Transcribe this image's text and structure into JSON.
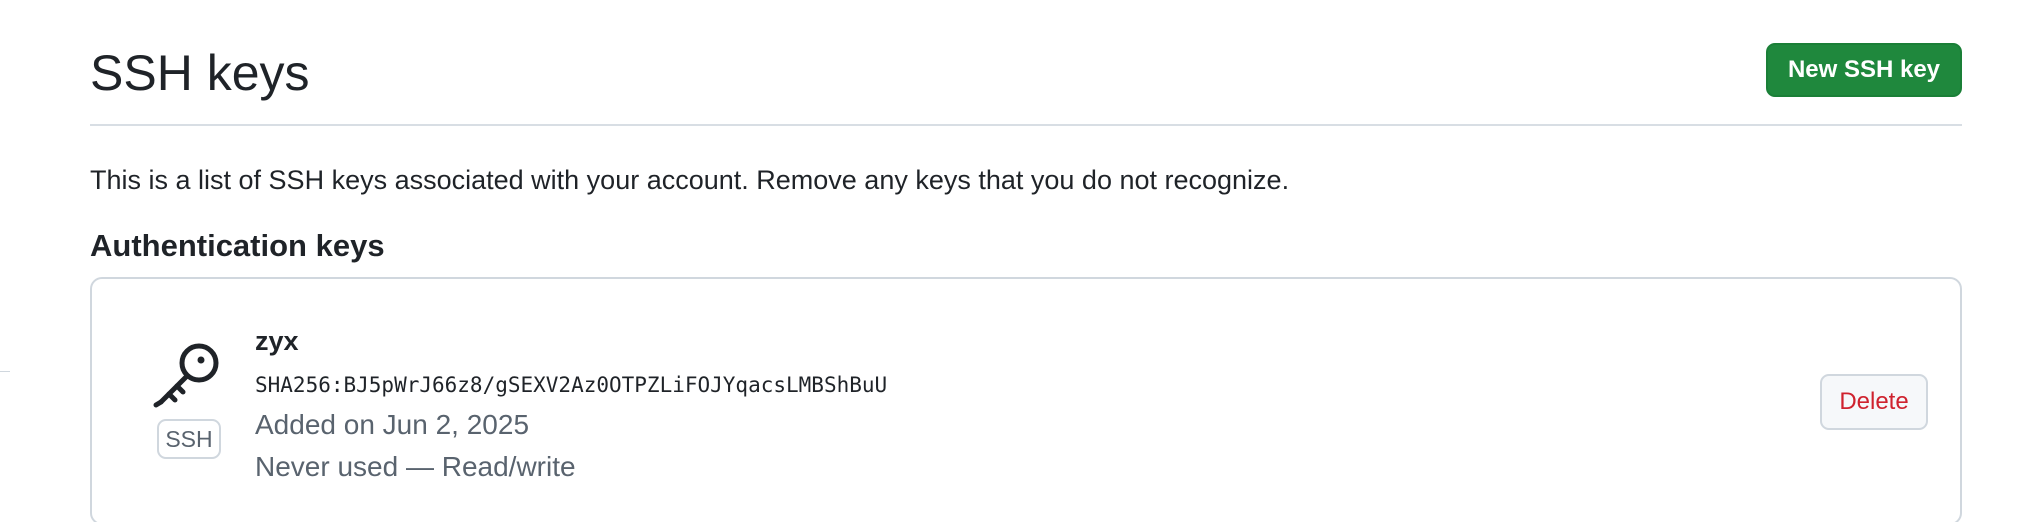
{
  "header": {
    "title": "SSH keys",
    "new_key_label": "New SSH key"
  },
  "description": "This is a list of SSH keys associated with your account. Remove any keys that you do not recognize.",
  "section_title": "Authentication keys",
  "keys": [
    {
      "name": "zyx",
      "type_label": "SSH",
      "fingerprint": "SHA256:BJ5pWrJ66z8/gSEXV2Az0OTPZLiFOJYqacsLMBShBuU",
      "added": "Added on Jun 2, 2025",
      "usage": "Never used — Read/write",
      "delete_label": "Delete",
      "icon": "key-icon"
    }
  ],
  "colors": {
    "primary_button": "#1f883d",
    "danger_text": "#cf222e",
    "border": "#d0d7de",
    "muted_text": "#59636e"
  }
}
